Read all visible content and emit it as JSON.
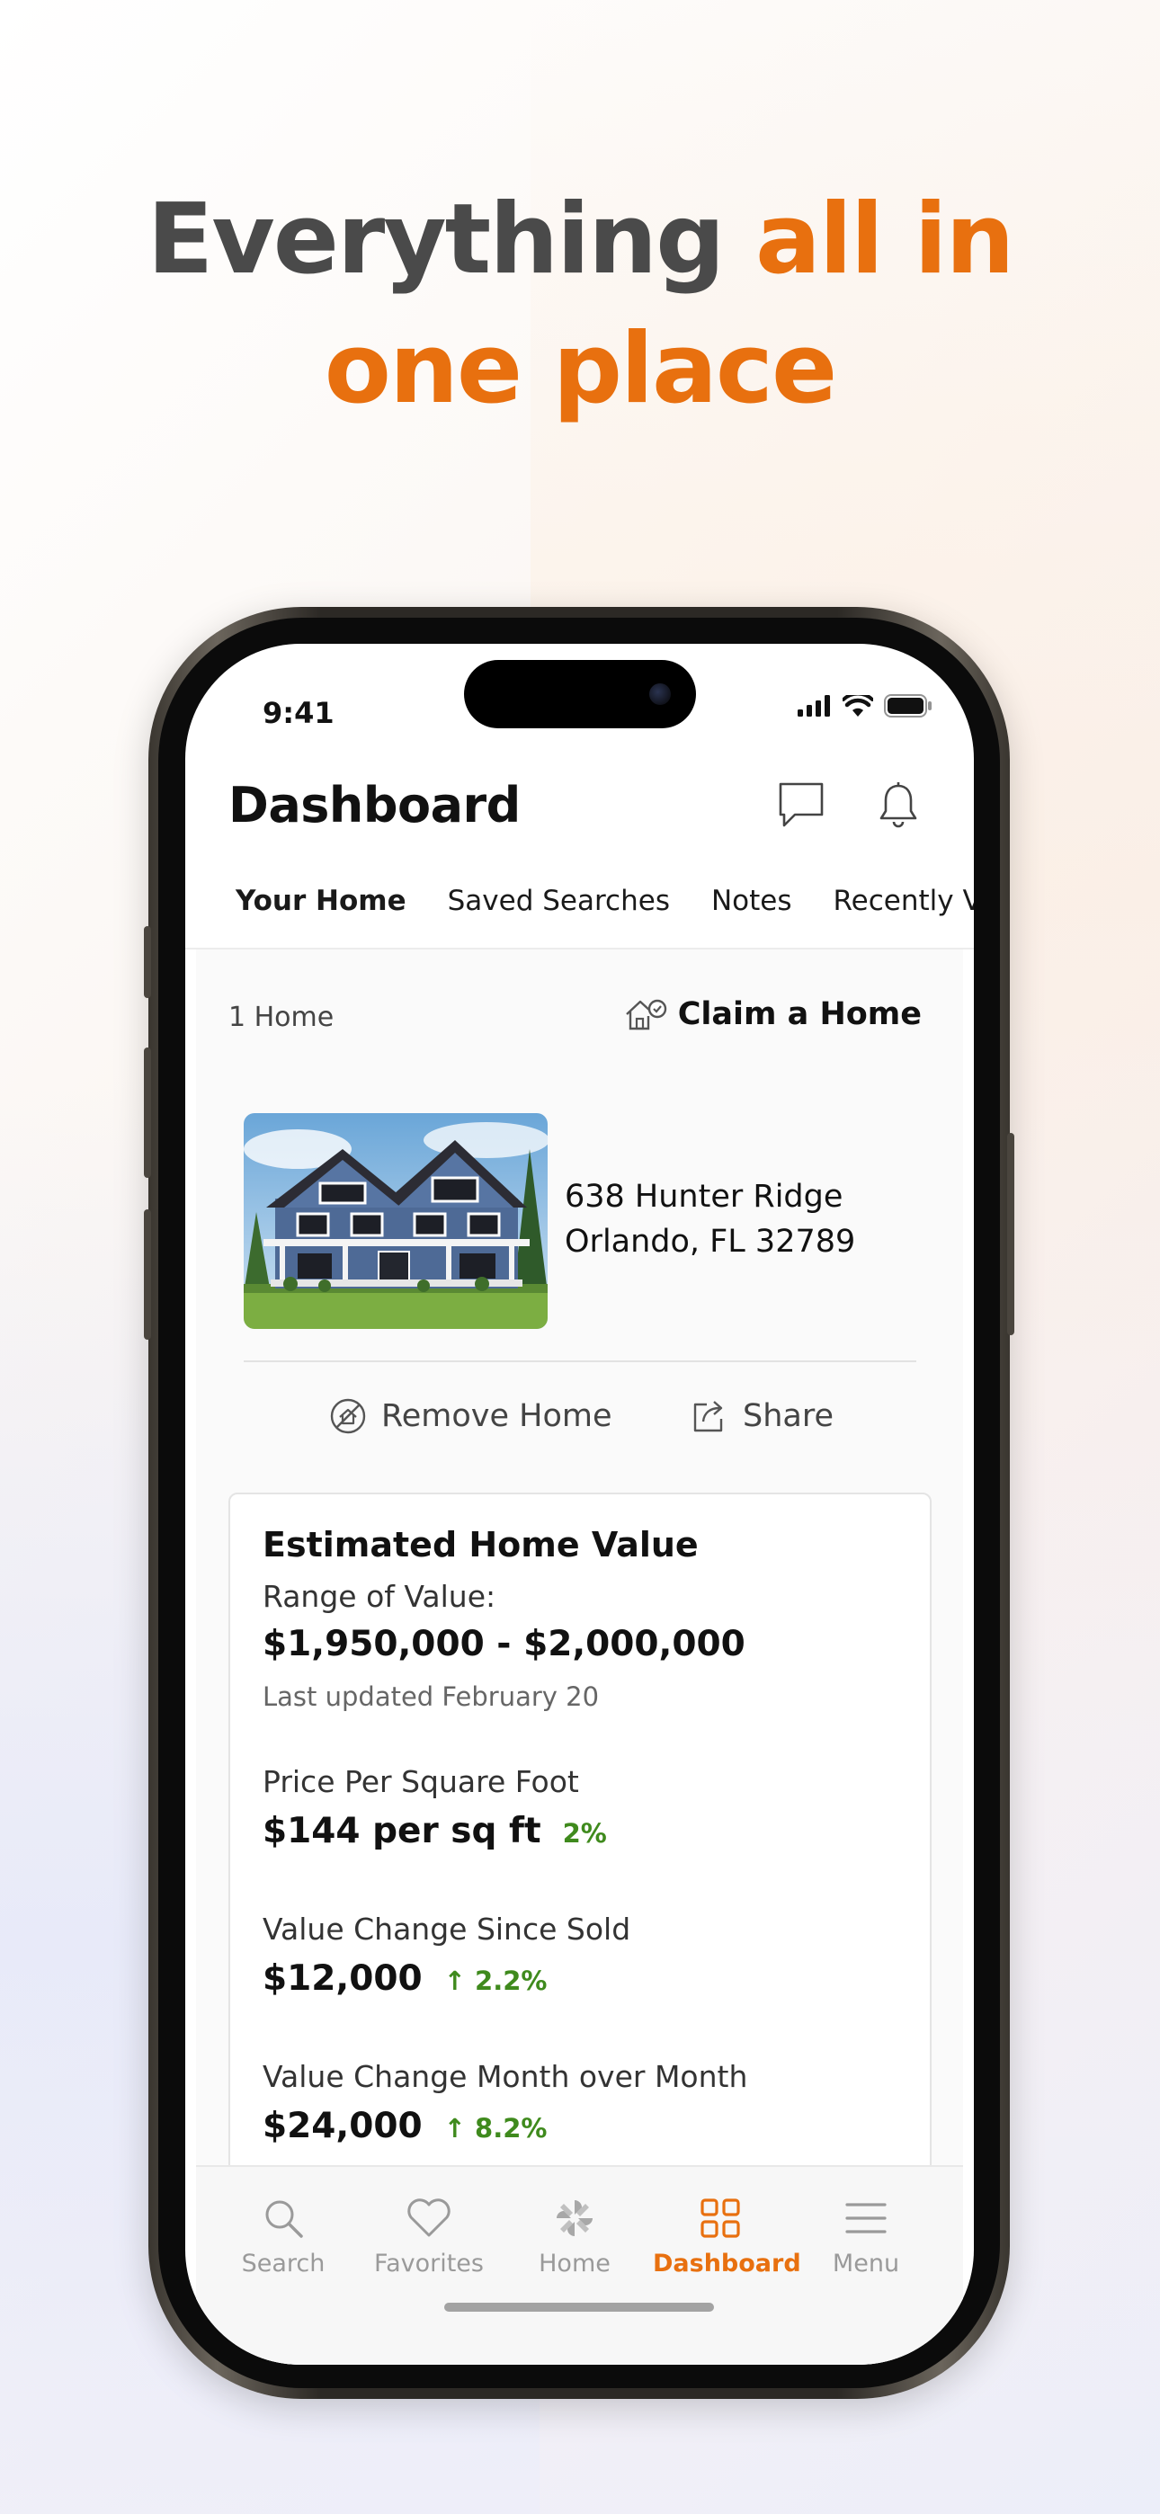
{
  "headline": {
    "line1_dark": "Everything",
    "line1_accent": "all in",
    "line2_accent": "one place"
  },
  "colors": {
    "accent": "#e8700f",
    "positive": "#3f8a1d"
  },
  "status_bar": {
    "time": "9:41",
    "icons": [
      "signal-icon",
      "wifi-icon",
      "battery-icon"
    ]
  },
  "header": {
    "title": "Dashboard",
    "icons": [
      "chat-icon",
      "bell-icon"
    ]
  },
  "tabs": [
    {
      "label": "Your Home",
      "active": true
    },
    {
      "label": "Saved Searches"
    },
    {
      "label": "Notes"
    },
    {
      "label": "Recently Viewed"
    }
  ],
  "home_summary": {
    "count": "1 Home",
    "claim_label": "Claim a Home"
  },
  "property": {
    "address_line1": "638 Hunter Ridge",
    "address_line2": "Orlando, FL 32789"
  },
  "actions": {
    "remove": "Remove Home",
    "share": "Share"
  },
  "value_card": {
    "title": "Estimated Home Value",
    "range_label": "Range of Value:",
    "range_value": "$1,950,000 - $2,000,000",
    "updated": "Last updated February 20",
    "ppsf_label": "Price Per Square Foot",
    "ppsf_value": "$144 per sq ft",
    "ppsf_change": "2%",
    "since_sold_label": "Value Change Since Sold",
    "since_sold_value": "$12,000",
    "since_sold_change": "↑ 2.2%",
    "mom_label": "Value Change Month over Month",
    "mom_value": "$24,000",
    "mom_change": "↑ 8.2%"
  },
  "bottom_nav": [
    {
      "label": "Search",
      "icon": "search-icon"
    },
    {
      "label": "Favorites",
      "icon": "heart-icon"
    },
    {
      "label": "Home",
      "icon": "home-logo-icon"
    },
    {
      "label": "Dashboard",
      "icon": "grid-icon",
      "active": true
    },
    {
      "label": "Menu",
      "icon": "menu-icon"
    }
  ]
}
